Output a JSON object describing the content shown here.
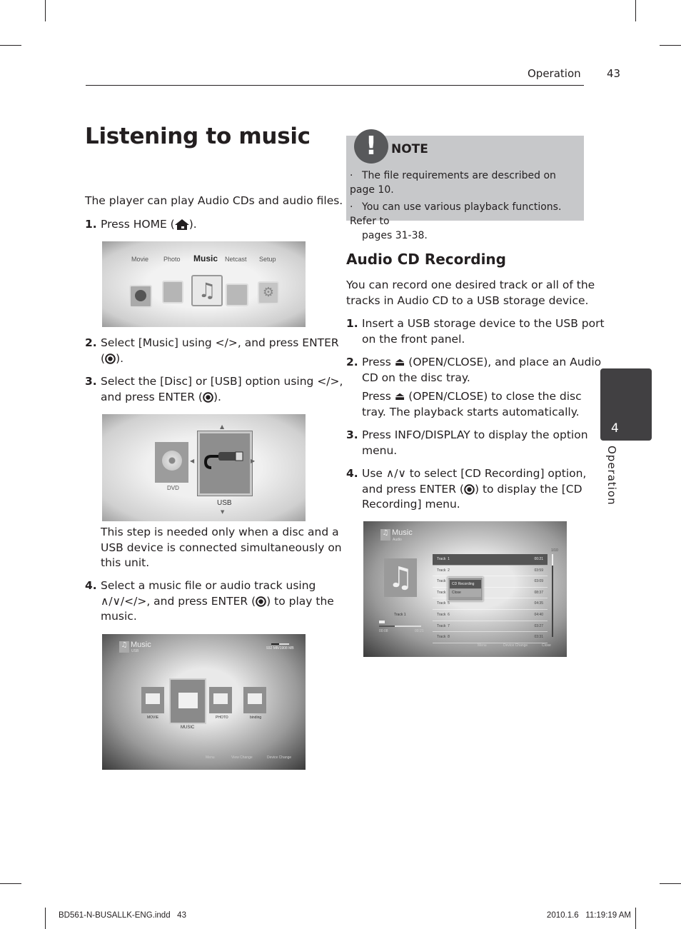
{
  "header": {
    "section": "Operation",
    "page_number": "43"
  },
  "title": "Listening to music",
  "intro": "The player can play Audio CDs and audio files.",
  "left_steps": [
    {
      "num": "1.",
      "text_before": "Press HOME (",
      "text_after": ")."
    },
    {
      "num": "2.",
      "line1": "Select [Music] using </>, and press ENTER",
      "line2_before": "(",
      "line2_after": ")."
    },
    {
      "num": "3.",
      "line1": "Select the [Disc] or [USB] option using </>,",
      "line2_before": "and press ENTER (",
      "line2_after": ")."
    },
    {
      "num": "4.",
      "line1": "Select a music file or audio track using",
      "line2_before": "∧/∨/</>, and press ENTER (",
      "line2_after": ") to play the",
      "line3": "music."
    }
  ],
  "step3_note": [
    "This step is needed only when a disc and a",
    "USB device is connected simultaneously on",
    "this unit."
  ],
  "home_menu": {
    "items": [
      "Movie",
      "Photo",
      "Music",
      "Netcast",
      "Setup"
    ],
    "selected": "Music"
  },
  "device_select": {
    "items": [
      "DVD",
      "USB"
    ],
    "selected": "USB"
  },
  "usb_browser": {
    "title": "Music",
    "subtitle": "USB",
    "storage": "932 MB/1908 MB",
    "folders": [
      "MOVIE",
      "MUSIC",
      "PHOTO",
      "binding"
    ],
    "selected": "MUSIC",
    "footer": [
      "Menu",
      "View Change",
      "Device Change"
    ]
  },
  "note": {
    "title": "NOTE",
    "items": [
      "The file requirements are described on page 10.",
      "You can use various playback functions. Refer to",
      "pages 31-38."
    ]
  },
  "section": {
    "title": "Audio CD Recording",
    "intro": [
      "You can record one desired track or all of the",
      "tracks in Audio CD to a USB storage device."
    ],
    "steps": [
      {
        "num": "1.",
        "lines": [
          "Insert a USB storage device to the USB port",
          "on the front panel."
        ]
      },
      {
        "num": "2.",
        "lines": [
          "Press ⏏ (OPEN/CLOSE), and place an Audio",
          "CD on the disc tray."
        ],
        "extra": [
          "Press ⏏ (OPEN/CLOSE) to close the disc",
          "tray. The playback starts automatically."
        ]
      },
      {
        "num": "3.",
        "lines": [
          "Press INFO/DISPLAY to display the option",
          "menu."
        ]
      },
      {
        "num": "4.",
        "line1": "Use ∧/∨ to select [CD Recording] option,",
        "line2_before": "and press ENTER (",
        "line2_after": ") to display the [CD",
        "line3": "Recording] menu."
      }
    ]
  },
  "cd_screen": {
    "title": "Music",
    "subtitle": "Audio",
    "page": "1/10",
    "tracks": [
      {
        "name": "Track  1",
        "time": "00:21"
      },
      {
        "name": "Track  2",
        "time": "03:59"
      },
      {
        "name": "Track  3",
        "time": "03:09"
      },
      {
        "name": "Track  4",
        "time": "08:37"
      },
      {
        "name": "Track  5",
        "time": "04:35"
      },
      {
        "name": "Track  6",
        "time": "04:40"
      },
      {
        "name": "Track  7",
        "time": "03:27"
      },
      {
        "name": "Track  8",
        "time": "03:31"
      }
    ],
    "popup": [
      "CD Recording",
      "Close"
    ],
    "now_playing": "Track  1",
    "elapsed": "00:08",
    "total": "00:21",
    "progress": 0.38,
    "footer": [
      "Menu",
      "Device Change",
      "Close"
    ]
  },
  "side_tab": {
    "number": "4",
    "label": "Operation"
  },
  "footer": {
    "file": "BD561-N-BUSALLK-ENG.indd   43",
    "timestamp": "2010.1.6   11:19:19 AM"
  }
}
